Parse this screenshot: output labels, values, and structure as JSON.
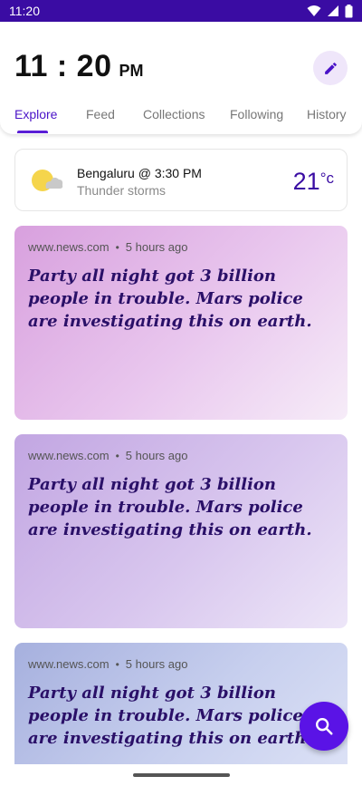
{
  "status_bar": {
    "time": "11:20"
  },
  "clock": {
    "time": "11 : 20",
    "ampm": "PM"
  },
  "tabs": [
    {
      "label": "Explore",
      "active": true
    },
    {
      "label": "Feed",
      "active": false
    },
    {
      "label": "Collections",
      "active": false
    },
    {
      "label": "Following",
      "active": false
    },
    {
      "label": "History",
      "active": false
    }
  ],
  "weather": {
    "city": "Bengaluru @ 3:30 PM",
    "description": "Thunder storms",
    "temperature": "21",
    "unit": "°c",
    "icon": "partly-cloudy-icon"
  },
  "cards": [
    {
      "source": "www.news.com",
      "time": "5 hours ago",
      "title": "Party all night got 3 billion people in trouble. Mars police are investigating this on earth."
    },
    {
      "source": "www.news.com",
      "time": "5 hours ago",
      "title": "Party all night got 3 billion people in trouble. Mars police are investigating this on earth."
    },
    {
      "source": "www.news.com",
      "time": "5 hours ago",
      "title": "Party all night got 3 billion people in trouble. Mars police are investigating this on earth."
    }
  ],
  "colors": {
    "status_bar": "#3a0ca3",
    "accent": "#5a13e6",
    "title_text": "#2a1068"
  }
}
